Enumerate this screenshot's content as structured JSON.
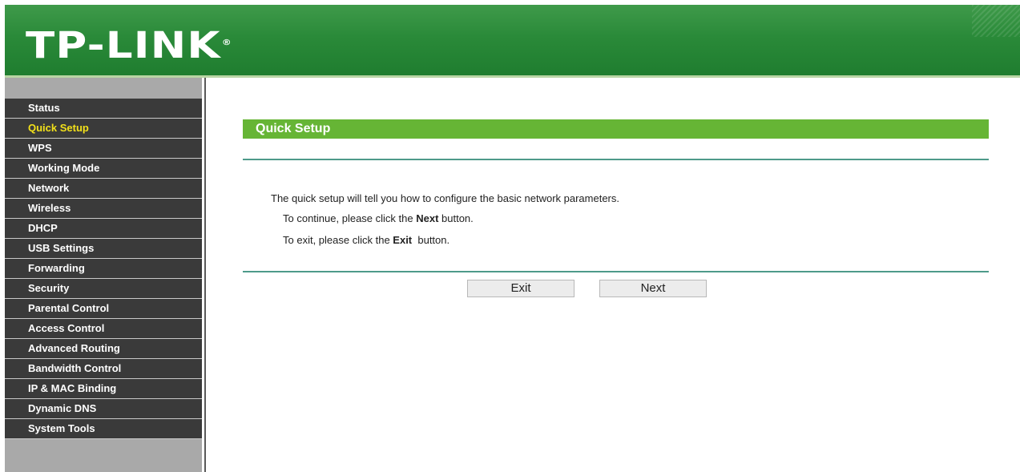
{
  "header": {
    "logo_text": "TP-LINK",
    "logo_mark": "®"
  },
  "sidebar": {
    "items": [
      {
        "label": "Status"
      },
      {
        "label": "Quick Setup",
        "active": true
      },
      {
        "label": "WPS"
      },
      {
        "label": "Working Mode"
      },
      {
        "label": "Network"
      },
      {
        "label": "Wireless"
      },
      {
        "label": "DHCP"
      },
      {
        "label": "USB Settings"
      },
      {
        "label": "Forwarding"
      },
      {
        "label": "Security"
      },
      {
        "label": "Parental Control"
      },
      {
        "label": "Access Control"
      },
      {
        "label": "Advanced Routing"
      },
      {
        "label": "Bandwidth Control"
      },
      {
        "label": "IP & MAC Binding"
      },
      {
        "label": "Dynamic DNS"
      },
      {
        "label": "System Tools"
      }
    ]
  },
  "main": {
    "title": "Quick Setup",
    "intro": "The quick setup will tell you how to configure the basic network parameters.",
    "continue_prefix": "To continue, please click the ",
    "continue_bold": "Next",
    "continue_suffix": " button.",
    "exit_prefix": "To exit, please click the ",
    "exit_bold": "Exit",
    "exit_suffix": "  button.",
    "buttons": {
      "exit": "Exit",
      "next": "Next"
    }
  },
  "colors": {
    "header_green": "#2a8a39",
    "title_bar_green": "#66b535",
    "menu_bg": "#3a3a3a",
    "active_menu_text": "#f2e01a",
    "divider": "#4e9a8a"
  }
}
